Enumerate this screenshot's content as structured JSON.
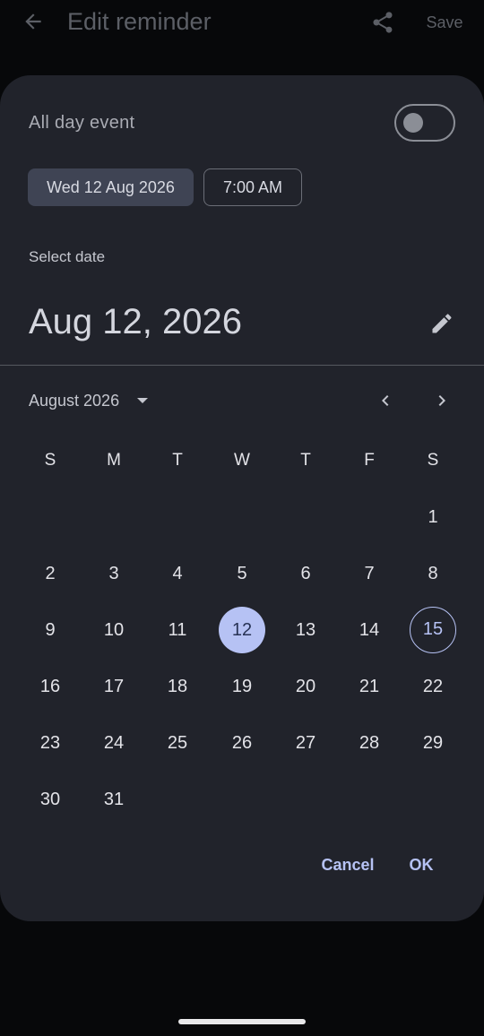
{
  "topbar": {
    "title": "Edit reminder",
    "save_label": "Save",
    "back_icon": "arrow-left-icon",
    "share_icon": "share-icon"
  },
  "reminder": {
    "all_day_label": "All day event",
    "all_day_on": false,
    "date_chip": "Wed 12 Aug 2026",
    "time_chip": "7:00 AM"
  },
  "picker": {
    "select_label": "Select date",
    "header_date": "Aug 12, 2026",
    "edit_icon": "pencil-icon",
    "month_label": "August 2026",
    "weekdays": [
      "S",
      "M",
      "T",
      "W",
      "T",
      "F",
      "S"
    ],
    "first_weekday_index": 6,
    "days_in_month": 31,
    "selected_day": 12,
    "today_day": 15,
    "cancel_label": "Cancel",
    "ok_label": "OK"
  },
  "colors": {
    "accent": "#b6c2f4",
    "sheet_bg": "#21232b",
    "page_bg": "#07080a"
  }
}
